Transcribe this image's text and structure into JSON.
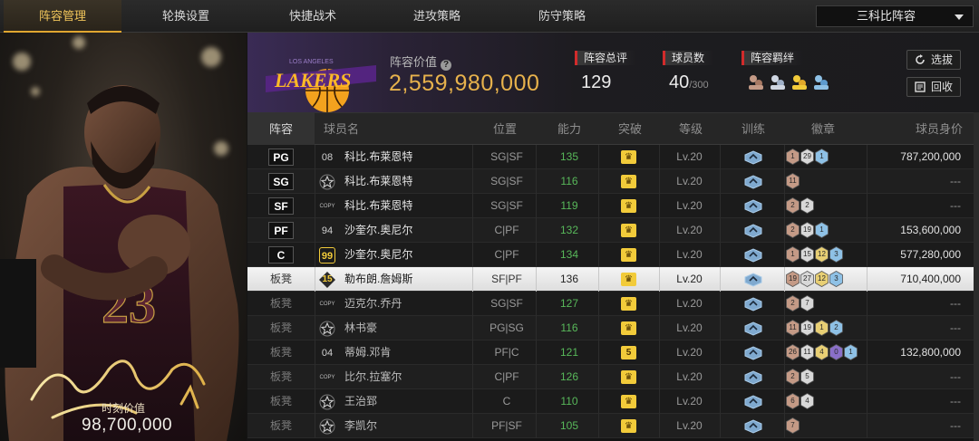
{
  "nav": {
    "tabs": [
      "阵容管理",
      "轮换设置",
      "快捷战术",
      "进攻策略",
      "防守策略"
    ],
    "active_tab": "阵容管理",
    "team_select": "三科比阵容"
  },
  "card": {
    "value_label": "时刻价值",
    "value": "98,700,000",
    "jersey_number": "23"
  },
  "team": {
    "logo_text": "LAKERS",
    "logo_subtext": "LOS ANGELES",
    "value_label": "阵容价值",
    "value": "2,559,980,000",
    "rating_label": "阵容总评",
    "rating": "129",
    "count_label": "球员数",
    "count": "40",
    "count_max": "/300",
    "bonds_label": "阵容羁绊",
    "select_button": "选拔",
    "recycle_button": "回收"
  },
  "table": {
    "headers": [
      "阵容",
      "球员名",
      "位置",
      "能力",
      "突破",
      "等级",
      "训练",
      "徽章",
      "球员身价"
    ],
    "rows": [
      {
        "slot": "PG",
        "bench": false,
        "num": "08",
        "num_style": "plain",
        "name": "科比.布莱恩特",
        "pos": "SG|SF",
        "ability": "135",
        "breakthrough": "♛",
        "level": "Lv.20",
        "badges": [
          {
            "c": "#c49a86",
            "n": "1"
          },
          {
            "c": "#d8d8d8",
            "n": "29"
          },
          {
            "c": "#8ec1e6",
            "n": "1"
          }
        ],
        "worth": "787,200,000"
      },
      {
        "slot": "SG",
        "bench": false,
        "num": "",
        "num_style": "star",
        "name": "科比.布莱恩特",
        "pos": "SG|SF",
        "ability": "116",
        "breakthrough": "♛",
        "level": "Lv.20",
        "badges": [
          {
            "c": "#c49a86",
            "n": "11"
          }
        ],
        "worth": "---"
      },
      {
        "slot": "SF",
        "bench": false,
        "num": "COPY",
        "num_style": "copy",
        "name": "科比.布莱恩特",
        "pos": "SG|SF",
        "ability": "119",
        "breakthrough": "♛",
        "level": "Lv.20",
        "badges": [
          {
            "c": "#c49a86",
            "n": "2"
          },
          {
            "c": "#d8d8d8",
            "n": "2"
          }
        ],
        "worth": "---"
      },
      {
        "slot": "PF",
        "bench": false,
        "num": "94",
        "num_style": "plain",
        "name": "沙奎尔.奥尼尔",
        "pos": "C|PF",
        "ability": "132",
        "breakthrough": "♛",
        "level": "Lv.20",
        "badges": [
          {
            "c": "#c49a86",
            "n": "2"
          },
          {
            "c": "#d8d8d8",
            "n": "19"
          },
          {
            "c": "#8ec1e6",
            "n": "1"
          }
        ],
        "worth": "153,600,000"
      },
      {
        "slot": "C",
        "bench": false,
        "num": "99",
        "num_style": "gold",
        "name": "沙奎尔.奥尼尔",
        "pos": "C|PF",
        "ability": "134",
        "breakthrough": "♛",
        "level": "Lv.20",
        "badges": [
          {
            "c": "#c49a86",
            "n": "1"
          },
          {
            "c": "#d8d8d8",
            "n": "15"
          },
          {
            "c": "#e8cf74",
            "n": "12"
          },
          {
            "c": "#8ec1e6",
            "n": "3"
          }
        ],
        "worth": "577,280,000"
      },
      {
        "slot": "板凳",
        "bench": true,
        "selected": true,
        "num": "15",
        "num_style": "diamond",
        "name": "勒布朗.詹姆斯",
        "pos": "SF|PF",
        "ability": "136",
        "breakthrough": "♛",
        "level": "Lv.20",
        "badges": [
          {
            "c": "#c49a86",
            "n": "19"
          },
          {
            "c": "#d8d8d8",
            "n": "27"
          },
          {
            "c": "#e8cf74",
            "n": "12"
          },
          {
            "c": "#8ec1e6",
            "n": "3"
          }
        ],
        "worth": "710,400,000"
      },
      {
        "slot": "板凳",
        "bench": true,
        "num": "COPY",
        "num_style": "copy",
        "name": "迈克尔.乔丹",
        "pos": "SG|SF",
        "ability": "127",
        "breakthrough": "♛",
        "level": "Lv.20",
        "badges": [
          {
            "c": "#c49a86",
            "n": "2"
          },
          {
            "c": "#d8d8d8",
            "n": "7"
          }
        ],
        "worth": "---"
      },
      {
        "slot": "板凳",
        "bench": true,
        "num": "",
        "num_style": "star",
        "name": "林书豪",
        "pos": "PG|SG",
        "ability": "116",
        "breakthrough": "♛",
        "level": "Lv.20",
        "badges": [
          {
            "c": "#c49a86",
            "n": "11"
          },
          {
            "c": "#d8d8d8",
            "n": "19"
          },
          {
            "c": "#e8cf74",
            "n": "1"
          },
          {
            "c": "#8ec1e6",
            "n": "2"
          }
        ],
        "worth": "---"
      },
      {
        "slot": "板凳",
        "bench": true,
        "num": "04",
        "num_style": "plain",
        "name": "蒂姆.邓肯",
        "pos": "PF|C",
        "ability": "121",
        "breakthrough": "5",
        "level": "Lv.20",
        "badges": [
          {
            "c": "#c49a86",
            "n": "26"
          },
          {
            "c": "#d8d8d8",
            "n": "11"
          },
          {
            "c": "#e8cf74",
            "n": "4"
          },
          {
            "c": "#8a6fc8",
            "n": "0"
          },
          {
            "c": "#8ec1e6",
            "n": "1"
          }
        ],
        "worth": "132,800,000"
      },
      {
        "slot": "板凳",
        "bench": true,
        "num": "COPY",
        "num_style": "copy",
        "name": "比尔.拉塞尔",
        "pos": "C|PF",
        "ability": "126",
        "breakthrough": "♛",
        "level": "Lv.20",
        "badges": [
          {
            "c": "#c49a86",
            "n": "2"
          },
          {
            "c": "#d8d8d8",
            "n": "5"
          }
        ],
        "worth": "---"
      },
      {
        "slot": "板凳",
        "bench": true,
        "num": "",
        "num_style": "star",
        "name": "王治郅",
        "pos": "C",
        "ability": "110",
        "breakthrough": "♛",
        "level": "Lv.20",
        "badges": [
          {
            "c": "#c49a86",
            "n": "6"
          },
          {
            "c": "#d8d8d8",
            "n": "4"
          }
        ],
        "worth": "---"
      },
      {
        "slot": "板凳",
        "bench": true,
        "num": "",
        "num_style": "star",
        "name": "李凯尔",
        "pos": "PF|SF",
        "ability": "105",
        "breakthrough": "♛",
        "level": "Lv.20",
        "badges": [
          {
            "c": "#c49a86",
            "n": "7"
          }
        ],
        "worth": "---"
      }
    ]
  },
  "colors": {
    "accent": "#e7b24c",
    "ability_green": "#58b85a",
    "lakers_purple": "#552583",
    "lakers_gold": "#fdb927"
  }
}
